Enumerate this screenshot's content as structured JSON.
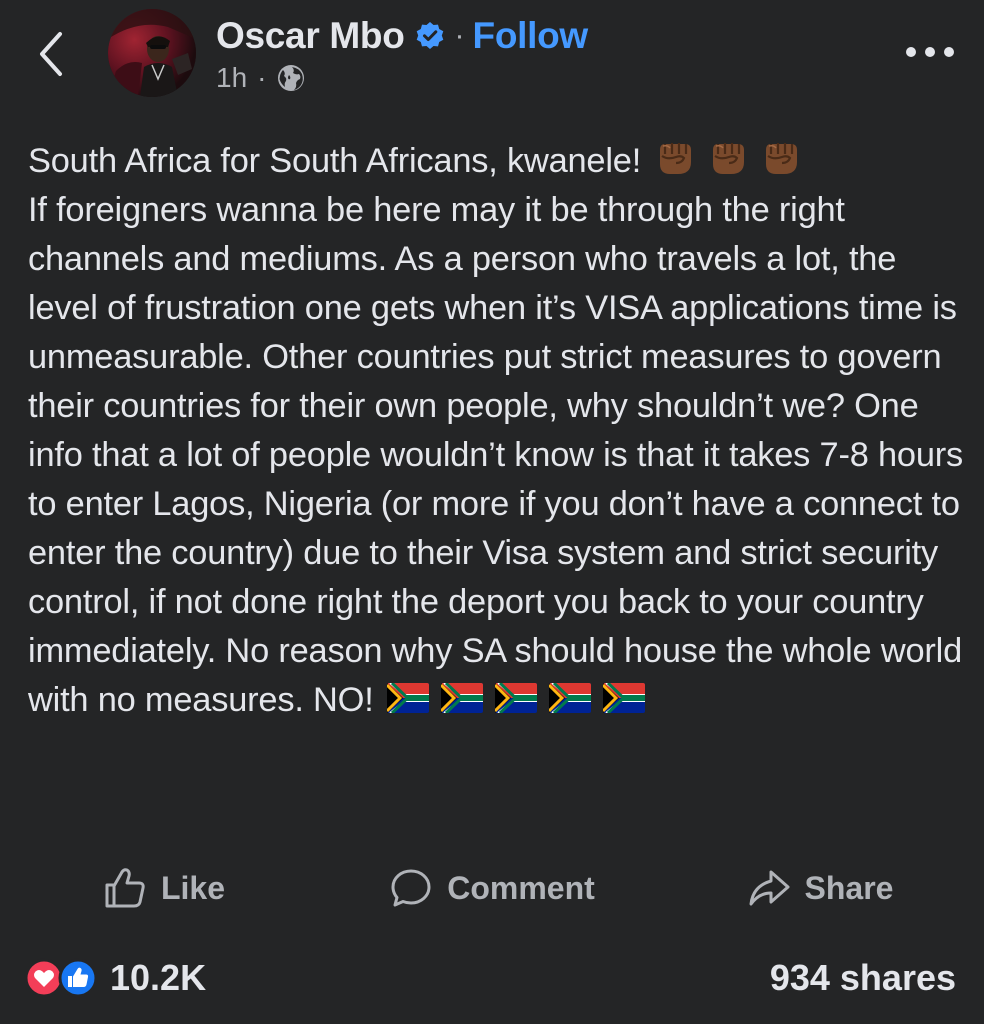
{
  "header": {
    "author_name": "Oscar Mbo",
    "dot": "·",
    "follow_label": "Follow",
    "timestamp": "1h",
    "meta_dot": "·",
    "audience_icon": "globe-icon",
    "back_icon": "chevron-left-icon",
    "more_icon": "more-horizontal-icon",
    "verified_color": "#4599ff"
  },
  "post": {
    "line_1": "South Africa for South Africans, kwanele!",
    "line_1_emojis": [
      "raised-fist-medium-dark-skin",
      "raised-fist-medium-dark-skin",
      "raised-fist-medium-dark-skin"
    ],
    "body": "If foreigners wanna be here may it be through the right channels and mediums. As a person who travels a lot, the level of frustration one gets when it’s VISA applications time is unmeasurable. Other countries put strict measures to govern their countries for their own people, why shouldn’t we? One info that a lot of people wouldn’t know is that it takes 7-8 hours to enter Lagos, Nigeria (or more if you don’t have a connect to enter the country) due to their Visa system and strict security control, if not done right the deport you back to your country immediately. No reason why SA should house the whole world with no measures. NO!",
    "end_emojis": [
      "flag-south-africa",
      "flag-south-africa",
      "flag-south-africa",
      "flag-south-africa",
      "flag-south-africa"
    ]
  },
  "actions": {
    "like_label": "Like",
    "comment_label": "Comment",
    "share_label": "Share"
  },
  "stats": {
    "reaction_count": "10.2K",
    "shares": "934 shares",
    "reactions": [
      "love",
      "like"
    ],
    "love_color": "#f33e58",
    "like_color": "#1877f2"
  },
  "theme": {
    "background": "#242526",
    "text": "#e4e6eb",
    "secondary_text": "#b0b3b8",
    "accent": "#4599ff"
  }
}
